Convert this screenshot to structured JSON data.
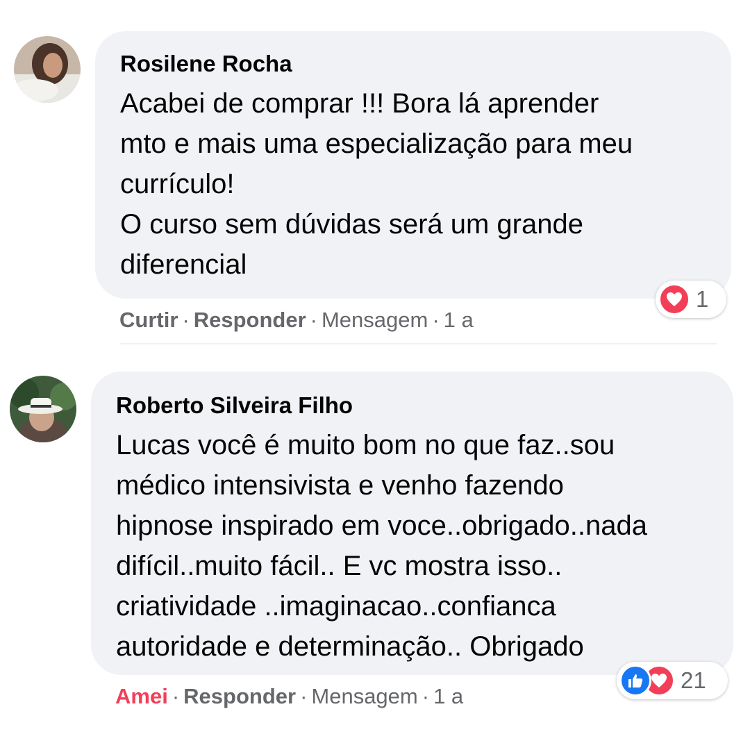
{
  "comments": [
    {
      "author": "Rosilene Rocha",
      "text": "Acabei de comprar !!! Bora lá aprender\nmto e mais uma especialização para meu\ncurrículo!\nO curso sem dúvidas será um grande\ndiferencial",
      "actions": {
        "like": "Curtir",
        "reply": "Responder",
        "message": "Mensagem",
        "time": "1 a"
      },
      "reactions": {
        "types": [
          "love-icon"
        ],
        "count": "1"
      }
    },
    {
      "author": "Roberto Silveira Filho",
      "text": "Lucas você é muito bom no que faz..sou\nmédico intensivista e venho fazendo\nhipnose inspirado em voce..obrigado..nada\ndifícil..muito fácil.. E vc mostra isso..\ncriatividade ..imaginacao..confianca\nautoridade e determinação.. Obrigado",
      "actions": {
        "like": "Amei",
        "reply": "Responder",
        "message": "Mensagem",
        "time": "1 a"
      },
      "reactions": {
        "types": [
          "like-icon",
          "love-icon"
        ],
        "count": "21"
      }
    }
  ],
  "colors": {
    "bubble": "#f0f2f5",
    "love": "#f33e58",
    "like": "#1877f2",
    "meta": "#65676b"
  }
}
